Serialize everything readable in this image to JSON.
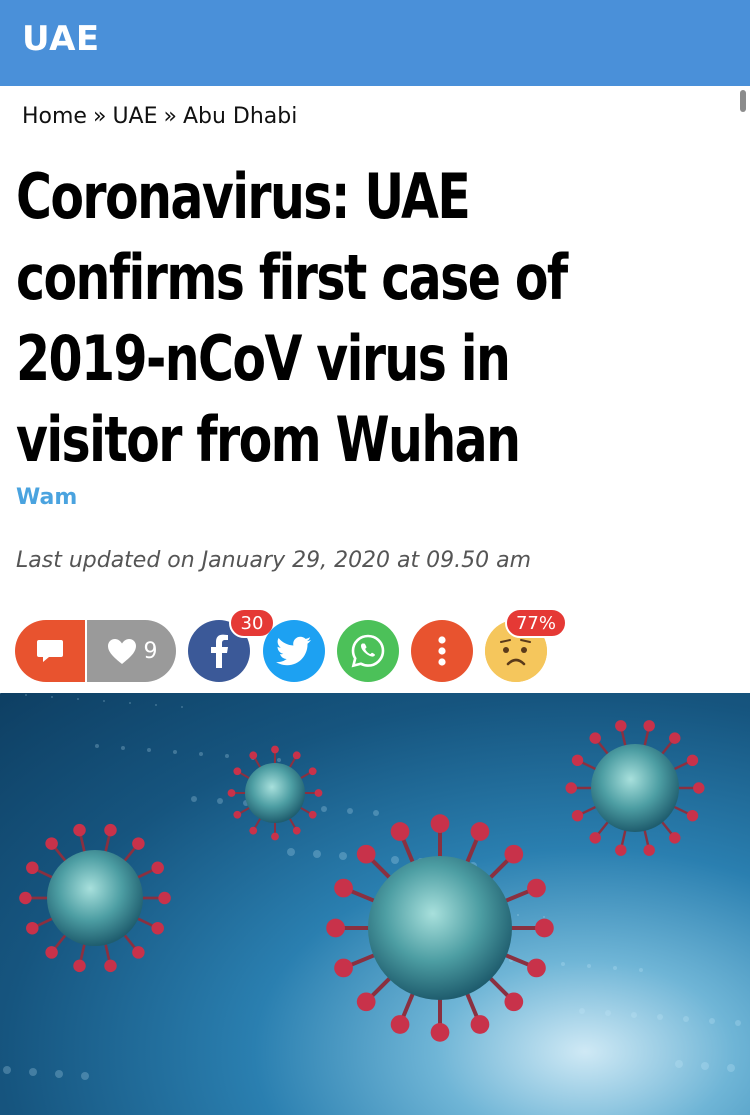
{
  "header": {
    "section": "UAE"
  },
  "breadcrumb": {
    "items": [
      "Home",
      "UAE",
      "Abu Dhabi"
    ],
    "separator": "»"
  },
  "article": {
    "headline_lines": [
      "Coronavirus: UAE",
      "confirms first case of",
      "2019-nCoV virus in",
      "visitor from Wuhan"
    ],
    "author": "Wam",
    "updated": "Last updated on January 29, 2020 at 09.50 am"
  },
  "actions": {
    "likes": "9",
    "facebook_count": "30",
    "reaction_percent": "77%"
  },
  "colors": {
    "header": "#4a90d9",
    "comment": "#e8532f",
    "like": "#9a9a9a",
    "facebook": "#3b5998",
    "twitter": "#1da1f2",
    "whatsapp": "#4cc159",
    "more": "#e8532f",
    "badge": "#e53935",
    "author": "#4aa3df"
  },
  "hero_image": {
    "subject": "coronavirus-particles-illustration"
  }
}
